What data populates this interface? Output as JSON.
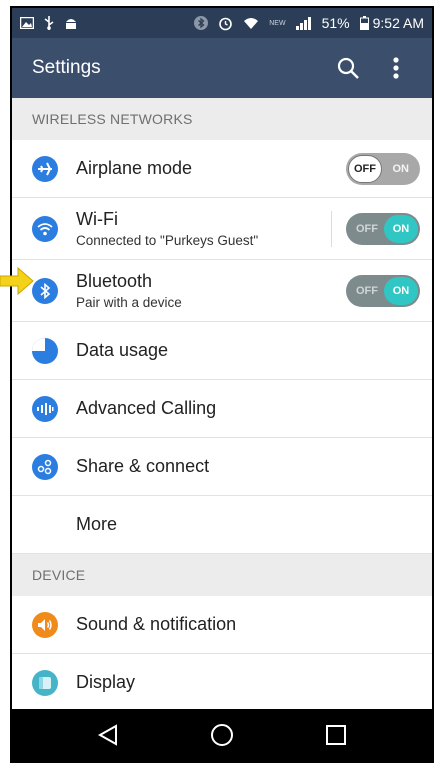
{
  "status_bar": {
    "battery": "51%",
    "time": "9:52 AM",
    "network_label": "NEW",
    "icons": [
      "image-icon",
      "usb-icon",
      "android-icon",
      "bluetooth-icon",
      "alarm-icon",
      "wifi-icon",
      "signal-icon",
      "battery-icon"
    ]
  },
  "app_bar": {
    "title": "Settings",
    "icons": [
      "search-icon",
      "more-vert-icon"
    ]
  },
  "sections": {
    "wireless": {
      "header": "WIRELESS NETWORKS",
      "airplane": {
        "title": "Airplane mode",
        "toggle_knob": "OFF",
        "toggle_other": "ON",
        "state": "off"
      },
      "wifi": {
        "title": "Wi-Fi",
        "subtitle": "Connected to \"Purkeys Guest\"",
        "toggle_knob": "ON",
        "toggle_other": "OFF",
        "state": "on"
      },
      "bluetooth": {
        "title": "Bluetooth",
        "subtitle": "Pair with a device",
        "toggle_knob": "ON",
        "toggle_other": "OFF",
        "state": "on"
      },
      "data_usage": {
        "title": "Data usage"
      },
      "advanced_calling": {
        "title": "Advanced Calling"
      },
      "share_connect": {
        "title": "Share & connect"
      },
      "more": {
        "title": "More"
      }
    },
    "device": {
      "header": "DEVICE",
      "sound": {
        "title": "Sound & notification"
      },
      "display": {
        "title": "Display"
      }
    }
  },
  "nav_bar": {
    "icons": [
      "back-icon",
      "home-icon",
      "recents-icon"
    ]
  },
  "colors": {
    "app_bar": "#3b4f6c",
    "status_bar": "#2c3e57",
    "accent_blue": "#2b7de0",
    "toggle_on": "#2fc6c4",
    "sound_orange": "#f08a1a",
    "display_teal": "#46b4c8",
    "arrow_yellow": "#f5d21a"
  }
}
